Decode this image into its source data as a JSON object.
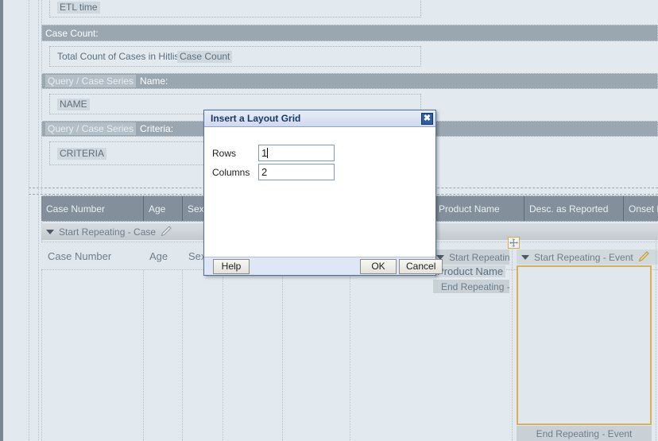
{
  "form": {
    "etl_time_label": "ETL time",
    "case_count_band": "Case Count:",
    "total_count_label": "Total Count of Cases in Hitlist:",
    "case_count_field": "Case Count",
    "name_band_token": "Query / Case Series",
    "name_band_label": "Name:",
    "name_field": "NAME",
    "criteria_band_token": "Query / Case Series",
    "criteria_band_label": "Criteria:",
    "criteria_field": "CRITERIA"
  },
  "table": {
    "headers": [
      "Case Number",
      "Age",
      "Sex",
      "Product Name",
      "Desc. as Reported",
      "Onset Dat"
    ],
    "repeat_start_case": "Start Repeating - Case",
    "row_values": [
      "Case Number",
      "Age",
      "Sex",
      "Product Name"
    ]
  },
  "event_panel": {
    "start_repeating_left": "Start Repeating",
    "product_name_field": "Product Name",
    "end_repeating_left": "End Repeating -",
    "start_repeating_event": "Start Repeating - Event",
    "end_repeating_event": "End Repeating - Event",
    "drag_handle_icon": "move-icon",
    "edit_icon": "pencil-icon"
  },
  "dialog": {
    "title": "Insert a Layout Grid",
    "close_label": "✖",
    "rows_label": "Rows",
    "rows_value": "1",
    "columns_label": "Columns",
    "columns_value": "2",
    "help_label": "Help",
    "ok_label": "OK",
    "cancel_label": "Cancel"
  },
  "colors": {
    "page_bg": "#e3eaef",
    "band_gray": "#9aa6b0",
    "table_head": "#838f9a",
    "dialog_chrome": "#dfe6f5",
    "dialog_border": "#4f6f96",
    "accent_orange": "#d9b05a",
    "title_text": "#17385e"
  }
}
